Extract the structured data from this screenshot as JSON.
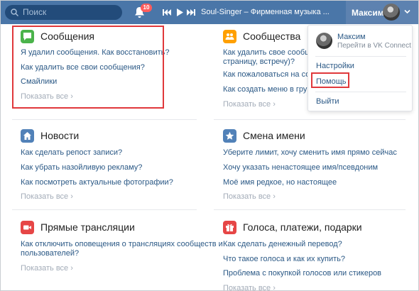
{
  "topbar": {
    "search_placeholder": "Поиск",
    "notifications_count": "10",
    "track_title": "Soul-Singer – Фирменная музыка ...",
    "user_name": "Максим"
  },
  "dropdown": {
    "profile_name": "Максим",
    "profile_sub": "Перейти в VK Connect",
    "settings": "Настройки",
    "help": "Помощь",
    "logout": "Выйти"
  },
  "sections": {
    "messages": {
      "title": "Сообщения",
      "links": [
        "Я удалил сообщения. Как восстановить?",
        "Как удалить все свои сообщения?",
        "Смайлики"
      ],
      "more": "Показать все"
    },
    "communities": {
      "title": "Сообщества",
      "links": [
        "Как удалить свое сообщест",
        "страницу, встречу)?",
        "Как пожаловаться на сооб",
        "Как создать меню в групп"
      ],
      "more": "Показать все"
    },
    "news": {
      "title": "Новости",
      "links": [
        "Как сделать репост записи?",
        "Как убрать назойливую рекламу?",
        "Как посмотреть актуальные фотографии?"
      ],
      "more": "Показать все"
    },
    "name_change": {
      "title": "Смена имени",
      "links": [
        "Уберите лимит, хочу сменить имя прямо сейчас",
        "Хочу указать ненастоящее имя/псевдоним",
        "Моё имя редкое, но настоящее"
      ],
      "more": "Показать все"
    },
    "live": {
      "title": "Прямые трансляции",
      "links": [
        "Как отключить оповещения о трансляциях сообществ и",
        "пользователей?"
      ],
      "more": "Показать все"
    },
    "votes": {
      "title": "Голоса, платежи, подарки",
      "links": [
        "Как сделать денежный перевод?",
        "Что такое голоса и как их купить?",
        "Проблема с покупкой голосов или стикеров"
      ],
      "more": "Показать все"
    }
  },
  "colors": {
    "topbar": "#4a76a8",
    "link": "#2a5885",
    "highlight": "#e0383b",
    "messages_icon": "#4bb34b",
    "communities_icon": "#ffa000",
    "news_icon": "#5181b8",
    "name_icon": "#5181b8",
    "live_icon": "#e64646",
    "votes_icon": "#e64646"
  },
  "icons": [
    "search-icon",
    "bell-icon",
    "prev-track-icon",
    "play-icon",
    "next-track-icon",
    "chevron-down-icon",
    "chat-icon",
    "group-icon",
    "home-icon",
    "star-icon",
    "camera-icon",
    "gift-icon"
  ]
}
